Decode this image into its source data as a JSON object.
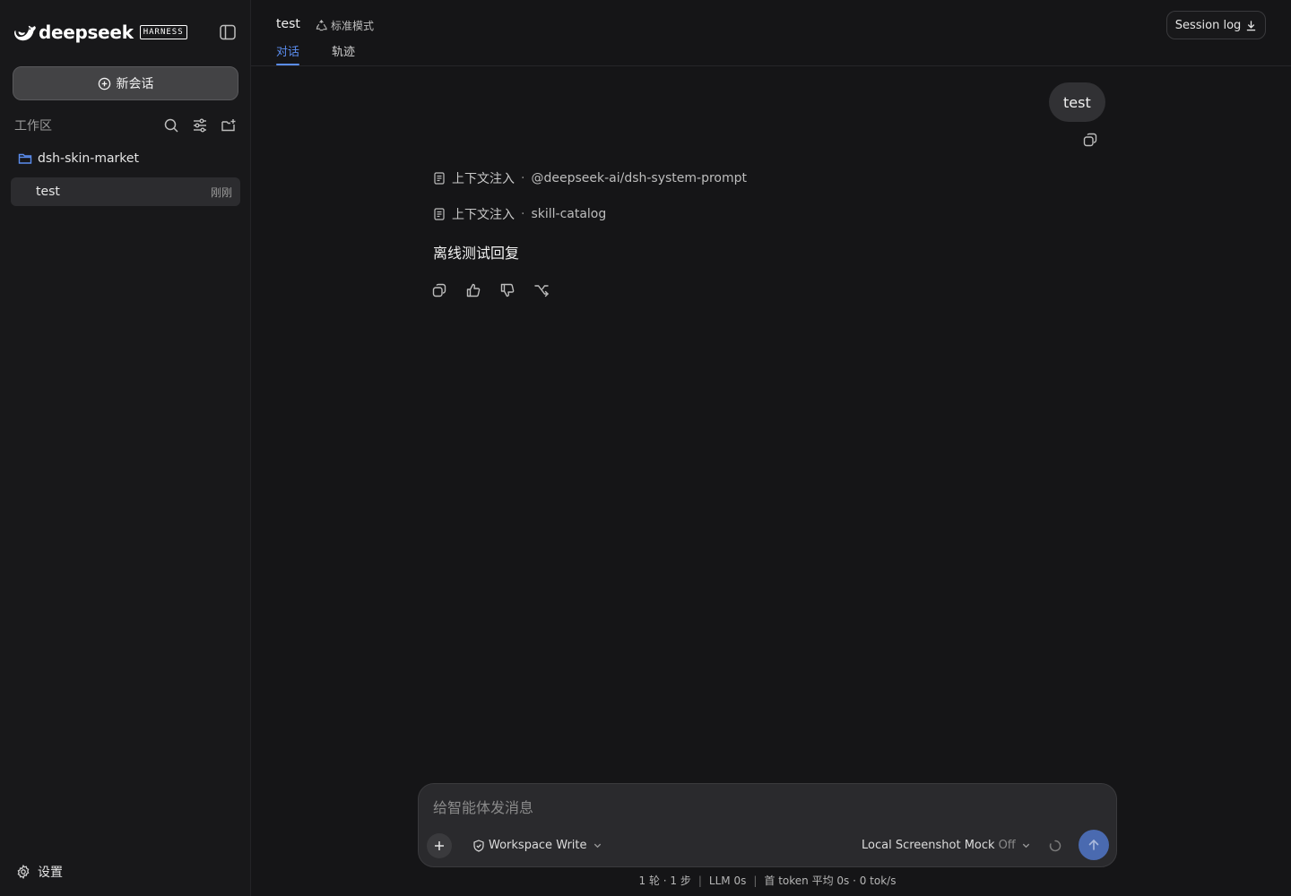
{
  "sidebar": {
    "brand": {
      "name": "deepseek",
      "badge": "HARNESS"
    },
    "new_chat_label": "新会话",
    "workspace_label": "工作区",
    "folder_name": "dsh-skin-market",
    "sessions": [
      {
        "title": "test",
        "time": "刚刚"
      }
    ],
    "settings_label": "设置"
  },
  "header": {
    "title": "test",
    "mode_label": "标准模式",
    "tabs": [
      {
        "label": "对话"
      },
      {
        "label": "轨迹"
      }
    ],
    "session_log_label": "Session log"
  },
  "conversation": {
    "user_message": "test",
    "injections": [
      {
        "label": "上下文注入",
        "target": "@deepseek-ai/dsh-system-prompt"
      },
      {
        "label": "上下文注入",
        "target": "skill-catalog"
      }
    ],
    "reply": "离线测试回复"
  },
  "composer": {
    "placeholder": "给智能体发消息",
    "permission_label": "Workspace Write",
    "mock_label": "Local Screenshot Mock",
    "mock_state": "Off"
  },
  "stats": {
    "turns": "1 轮 · 1 步",
    "llm": "LLM 0s",
    "tokens": "首 token 平均 0s · 0 tok/s"
  },
  "colors": {
    "accent": "#5b8def",
    "send_button": "#4a6ab0",
    "background": "#151517"
  },
  "icons": [
    "whale-logo-icon",
    "sidebar-toggle-icon",
    "plus-circle-icon",
    "search-icon",
    "sliders-icon",
    "new-folder-icon",
    "folder-icon",
    "gear-icon",
    "recycle-icon",
    "download-icon",
    "copy-icon",
    "document-icon",
    "thumbs-up-icon",
    "thumbs-down-icon",
    "branch-icon",
    "plus-icon",
    "shield-icon",
    "chevron-down-icon",
    "spinner-icon",
    "arrow-up-icon"
  ]
}
